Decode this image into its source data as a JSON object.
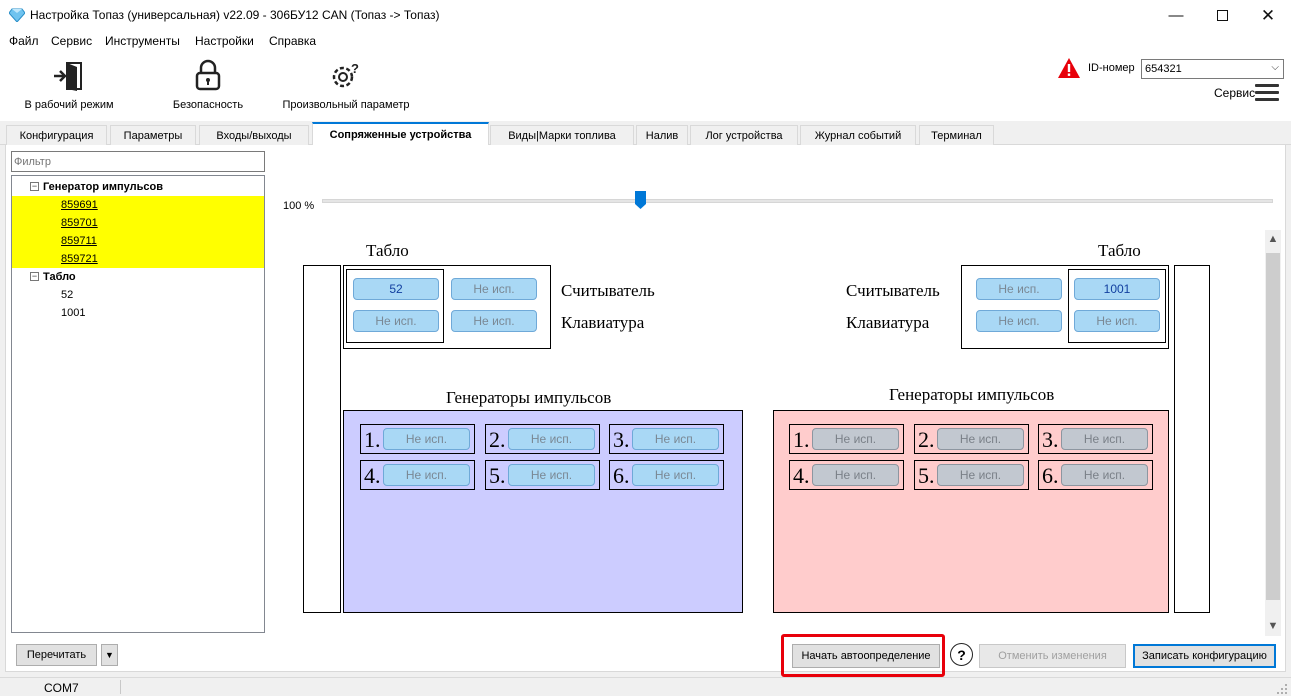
{
  "window": {
    "title": "Настройка Топаз (универсальная) v22.09 - 306БУ12 CAN (Топаз -> Топаз)",
    "app_icon": "diamond-icon",
    "controls": [
      "minimize-icon",
      "maximize-icon",
      "close-icon"
    ]
  },
  "menu": [
    "Файл",
    "Сервис",
    "Инструменты",
    "Настройки",
    "Справка"
  ],
  "toolbar": {
    "work_mode": "В рабочий режим",
    "security": "Безопасность",
    "custom_param": "Произвольный параметр",
    "id_label": "ID-номер",
    "id_value": "654321",
    "service_label": "Сервис"
  },
  "tabs": [
    "Конфигурация",
    "Параметры",
    "Входы/выходы",
    "Сопряженные устройства",
    "Виды|Марки топлива",
    "Налив",
    "Лог устройства",
    "Журнал событий",
    "Терминал"
  ],
  "active_tab": "Сопряженные устройства",
  "filter_placeholder": "Фильтр",
  "tree": {
    "group1": {
      "label": "Генератор импульсов",
      "items": [
        "859691",
        "859701",
        "859711",
        "859721"
      ]
    },
    "group2": {
      "label": "Табло",
      "items": [
        "52",
        "1001"
      ]
    }
  },
  "zoom_label": "100 %",
  "zoom_percent": 100,
  "diagram": {
    "left": {
      "tablo_title": "Табло",
      "reader_label": "Считыватель",
      "keyboard_label": "Клавиатура",
      "cells": [
        "52",
        "Не исп.",
        "Не исп.",
        "Не исп."
      ],
      "gen_title": "Генераторы импульсов",
      "gen_nums": [
        "1.",
        "2.",
        "3.",
        "4.",
        "5.",
        "6."
      ],
      "gen_values": [
        "Не исп.",
        "Не исп.",
        "Не исп.",
        "Не исп.",
        "Не исп.",
        "Не исп."
      ],
      "gen_color": "#ccccff"
    },
    "right": {
      "tablo_title": "Табло",
      "reader_label": "Считыватель",
      "keyboard_label": "Клавиатура",
      "cells": [
        "Не исп.",
        "1001",
        "Не исп.",
        "Не исп."
      ],
      "gen_title": "Генераторы импульсов",
      "gen_nums": [
        "1.",
        "2.",
        "3.",
        "4.",
        "5.",
        "6."
      ],
      "gen_values": [
        "Не исп.",
        "Не исп.",
        "Не исп.",
        "Не исп.",
        "Не исп.",
        "Не исп."
      ],
      "gen_color": "#ffcccc"
    }
  },
  "buttons": {
    "reread": "Перечитать",
    "autodetect": "Начать автоопределение",
    "help": "?",
    "cancel_changes": "Отменить изменения",
    "write_config": "Записать конфигурацию"
  },
  "status": {
    "port": "COM7"
  },
  "colors": {
    "accent": "#0078d7",
    "highlight": "#ffff00",
    "warning": "#e8000a"
  }
}
